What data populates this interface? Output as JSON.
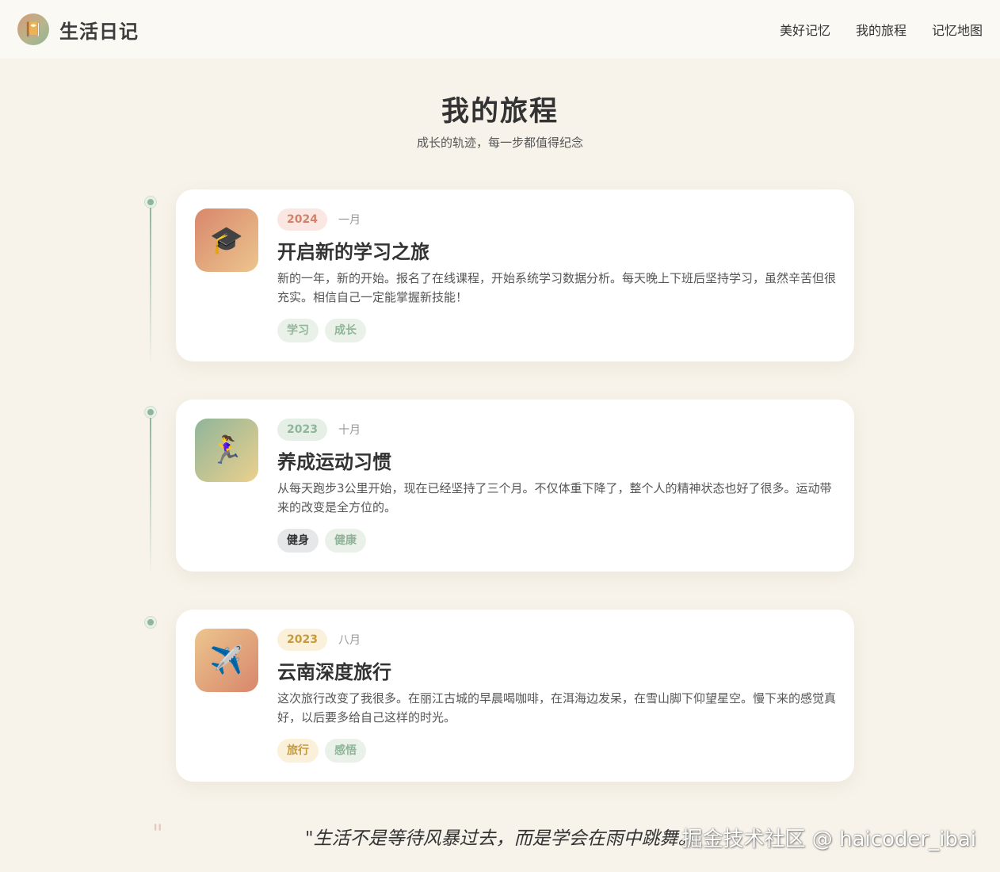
{
  "nav": {
    "logo_icon": "diary-icon",
    "logo_glyph": "📔",
    "brand": "生活日记",
    "links": [
      "美好记忆",
      "我的旅程",
      "记忆地图"
    ]
  },
  "hero": {
    "title": "我的旅程",
    "subtitle": "成长的轨迹，每一步都值得纪念"
  },
  "timeline": [
    {
      "icon": "graduation-cap-icon",
      "glyph": "🎓",
      "year": "2024",
      "month": "一月",
      "title": "开启新的学习之旅",
      "description": "新的一年，新的开始。报名了在线课程，开始系统学习数据分析。每天晚上下班后坚持学习，虽然辛苦但很充实。相信自己一定能掌握新技能！",
      "tags": [
        "学习",
        "成长"
      ]
    },
    {
      "icon": "runner-icon",
      "glyph": "🏃‍♀️",
      "year": "2023",
      "month": "十月",
      "title": "养成运动习惯",
      "description": "从每天跑步3公里开始，现在已经坚持了三个月。不仅体重下降了，整个人的精神状态也好了很多。运动带来的改变是全方位的。",
      "tags": [
        "健身",
        "健康"
      ]
    },
    {
      "icon": "airplane-icon",
      "glyph": "✈️",
      "year": "2023",
      "month": "八月",
      "title": "云南深度旅行",
      "description": "这次旅行改变了我很多。在丽江古城的早晨喝咖啡，在洱海边发呆，在雪山脚下仰望星空。慢下来的感觉真好，以后要多给自己这样的时光。",
      "tags": [
        "旅行",
        "感悟"
      ]
    }
  ],
  "quote": {
    "mark": "\"",
    "text": "\"生活不是等待风暴过去，而是学会在雨中跳舞。"
  },
  "watermark": "掘金技术社区 @ haicoder_ibai",
  "colors": {
    "accent_green": "#8fb59a",
    "year_2024_bg": "#fbe7e2",
    "year_2024_text": "#d1826a",
    "year_green_bg": "#e6efe6",
    "year_green_text": "#8fb59a",
    "year_gold_bg": "#fbf0da",
    "year_gold_text": "#c79a3c"
  }
}
